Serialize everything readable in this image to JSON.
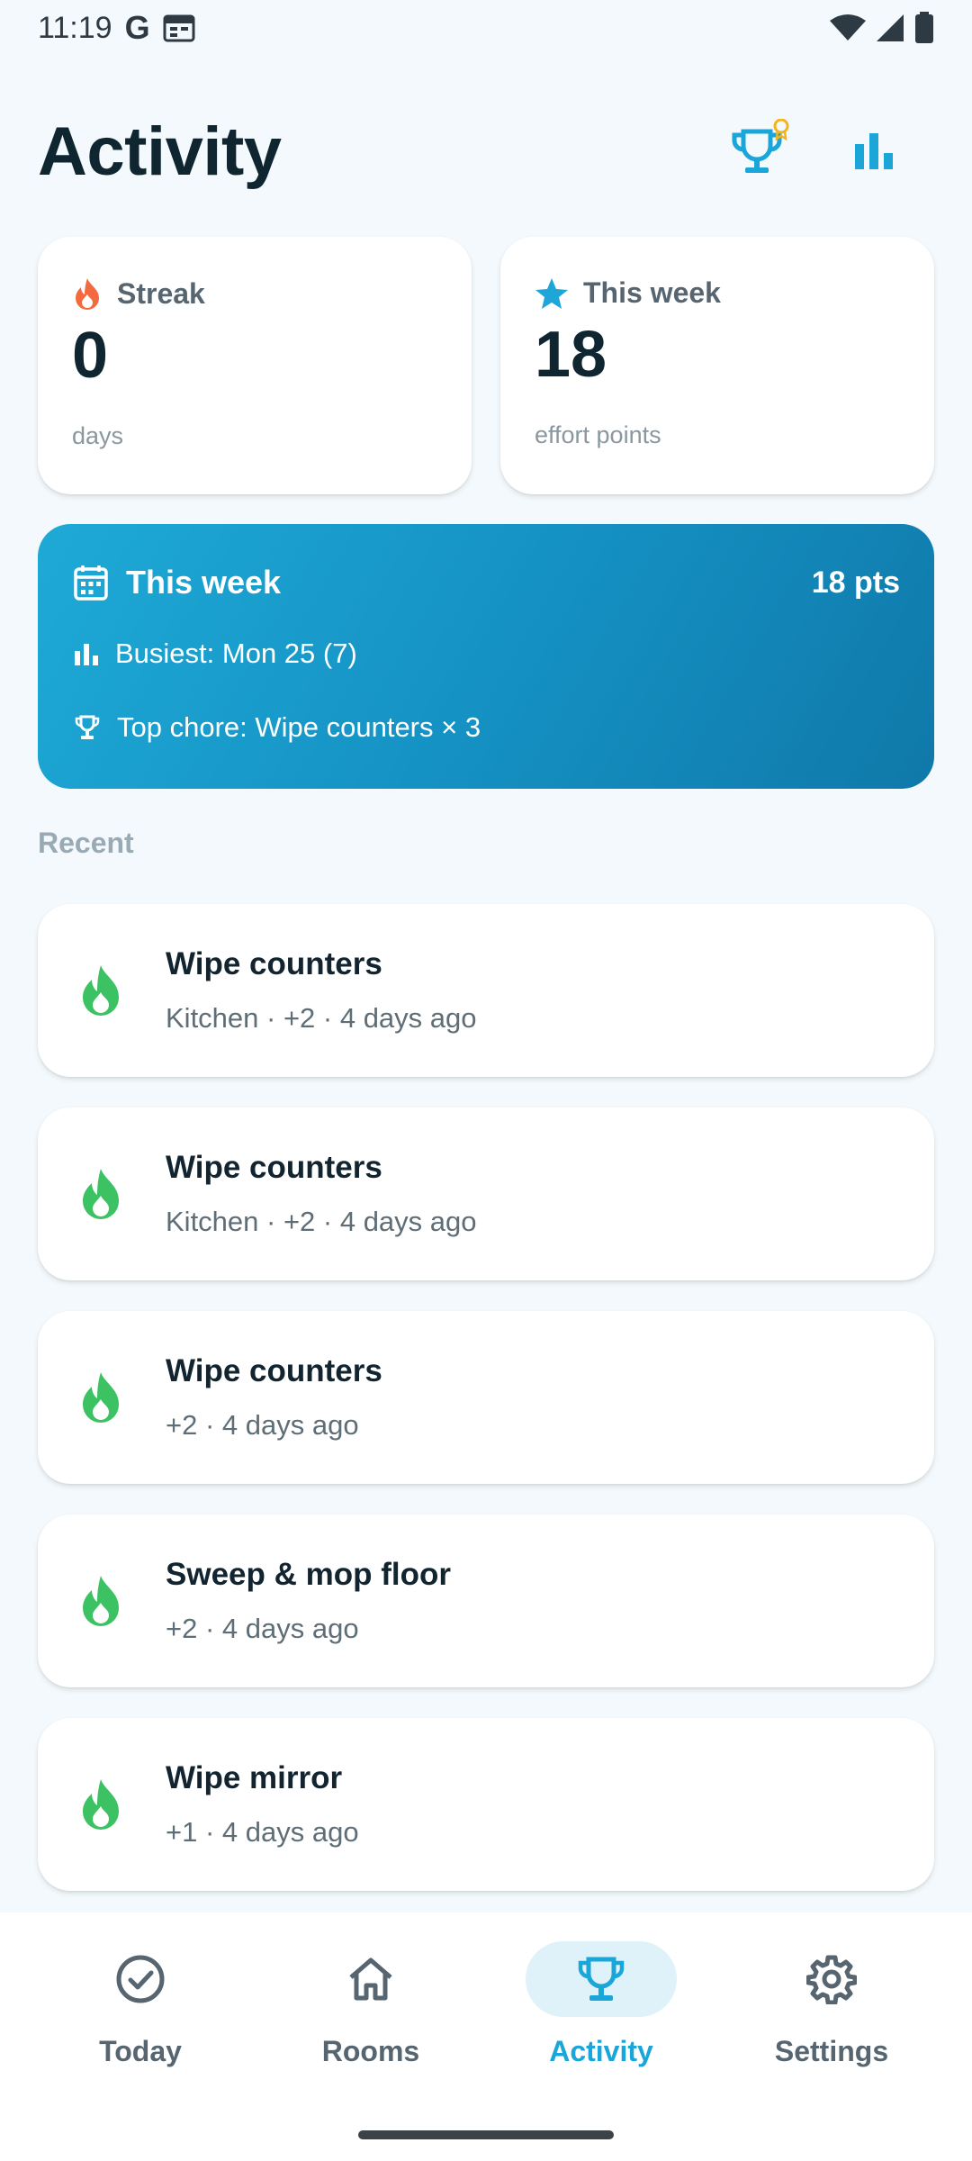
{
  "status_bar": {
    "time": "11:19",
    "google_glyph": "G"
  },
  "header": {
    "title": "Activity"
  },
  "stats": {
    "streak": {
      "label": "Streak",
      "value": "0",
      "unit": "days"
    },
    "week": {
      "label": "This week",
      "value": "18",
      "unit": "effort points"
    }
  },
  "week_summary": {
    "title": "This week",
    "points": "18 pts",
    "busiest": "Busiest: Mon 25 (7)",
    "top_chore": "Top chore: Wipe counters × 3"
  },
  "recent": {
    "label": "Recent",
    "items": [
      {
        "title": "Wipe counters",
        "subtitle": "Kitchen · +2 · 4 days ago"
      },
      {
        "title": "Wipe counters",
        "subtitle": "Kitchen · +2 · 4 days ago"
      },
      {
        "title": "Wipe counters",
        "subtitle": "+2 · 4 days ago"
      },
      {
        "title": "Sweep & mop floor",
        "subtitle": "+2 · 4 days ago"
      },
      {
        "title": "Wipe mirror",
        "subtitle": "+1 · 4 days ago"
      }
    ]
  },
  "nav": {
    "today": "Today",
    "rooms": "Rooms",
    "activity": "Activity",
    "settings": "Settings"
  },
  "colors": {
    "accent": "#1aa6d8",
    "streak_orange": "#f26a3d",
    "star_blue": "#1ea6d9",
    "flame_green": "#3cc163",
    "badge_yellow": "#f4b41a"
  }
}
